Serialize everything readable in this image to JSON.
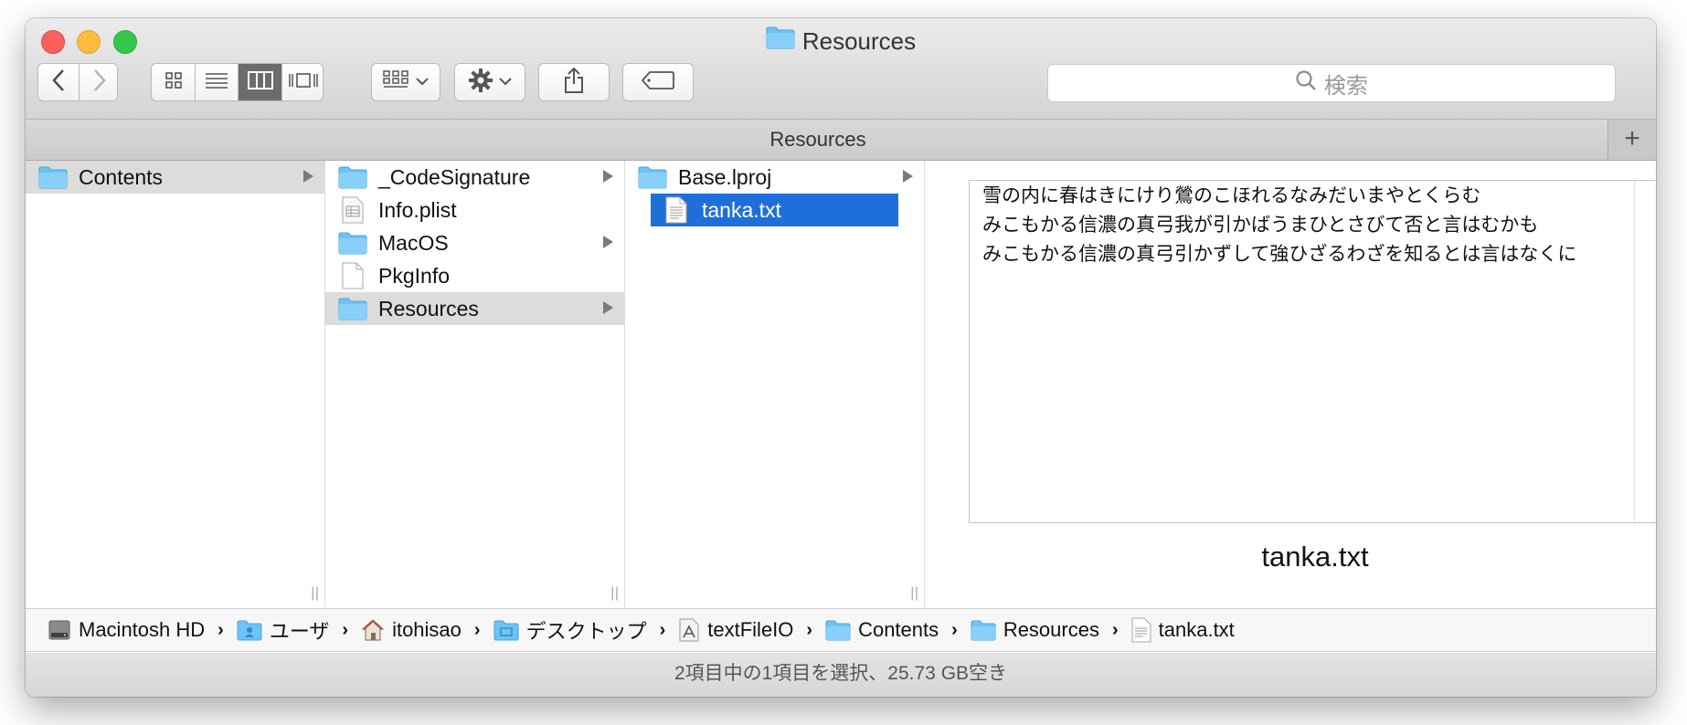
{
  "window": {
    "title": "Resources",
    "tab_label": "Resources",
    "new_tab_symbol": "+"
  },
  "toolbar": {
    "back_icon": "chevron-left-icon",
    "forward_icon": "chevron-right-icon",
    "view_modes": [
      "icon-view-icon",
      "list-view-icon",
      "column-view-icon",
      "cover-flow-icon"
    ],
    "active_view": "column-view-icon",
    "search_placeholder": "検索"
  },
  "columns": [
    {
      "items": [
        {
          "name": "Contents",
          "icon": "folder-icon",
          "has_children": true,
          "selected": "gray"
        }
      ]
    },
    {
      "items": [
        {
          "name": "_CodeSignature",
          "icon": "folder-icon",
          "has_children": true,
          "selected": "none"
        },
        {
          "name": "Info.plist",
          "icon": "plist-file-icon",
          "has_children": false,
          "selected": "none"
        },
        {
          "name": "MacOS",
          "icon": "folder-icon",
          "has_children": true,
          "selected": "none"
        },
        {
          "name": "PkgInfo",
          "icon": "blank-file-icon",
          "has_children": false,
          "selected": "none"
        },
        {
          "name": "Resources",
          "icon": "folder-icon",
          "has_children": true,
          "selected": "gray"
        }
      ]
    },
    {
      "items": [
        {
          "name": "Base.lproj",
          "icon": "folder-icon",
          "has_children": true,
          "selected": "none"
        },
        {
          "name": "tanka.txt",
          "icon": "text-file-icon",
          "has_children": false,
          "selected": "blue"
        }
      ]
    }
  ],
  "preview": {
    "lines": [
      "雪の内に春はきにけり鶯のこほれるなみだいまやとくらむ",
      "みこもかる信濃の真弓我が引かばうまひとさびて否と言はむかも",
      "みこもかる信濃の真弓引かずして強ひざるわざを知るとは言はなくに"
    ],
    "file_name": "tanka.txt"
  },
  "path_bar": [
    {
      "label": "Macintosh HD",
      "icon": "hard-drive-icon"
    },
    {
      "label": "ユーザ",
      "icon": "users-folder-icon"
    },
    {
      "label": "itohisao",
      "icon": "home-icon"
    },
    {
      "label": "デスクトップ",
      "icon": "desktop-folder-icon"
    },
    {
      "label": "textFileIO",
      "icon": "app-icon"
    },
    {
      "label": "Contents",
      "icon": "folder-icon"
    },
    {
      "label": "Resources",
      "icon": "folder-icon"
    },
    {
      "label": "tanka.txt",
      "icon": "text-file-icon"
    }
  ],
  "status": "2項目中の1項目を選択、25.73 GB空き",
  "colors": {
    "selection_blue": "#1f6fdb",
    "selection_gray": "#dcdcdc",
    "folder_blue": "#6cc3f5"
  }
}
